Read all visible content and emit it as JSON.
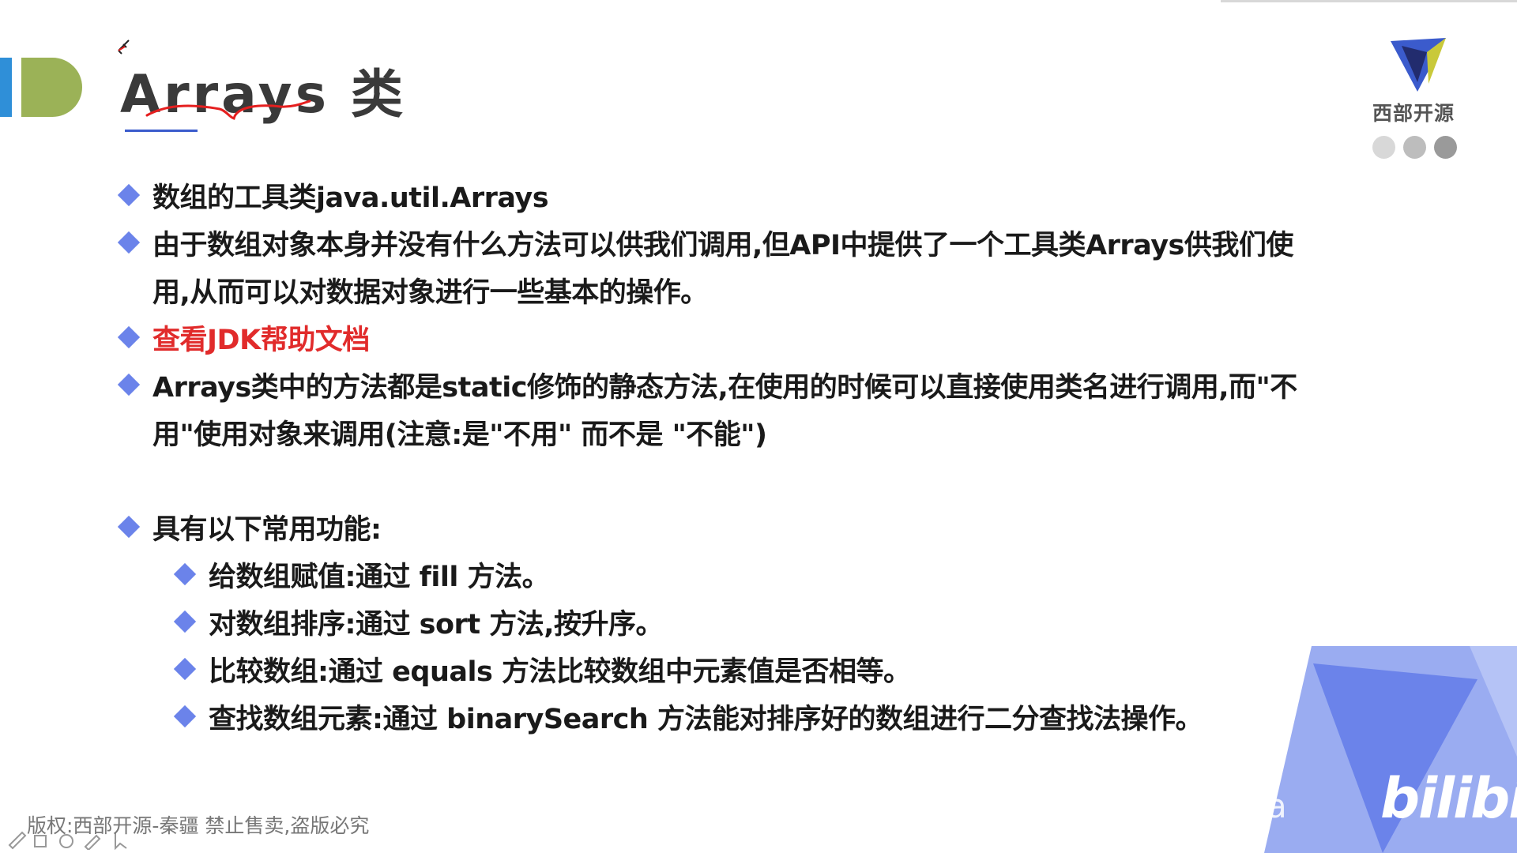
{
  "slide": {
    "title": "Arrays 类",
    "logo_text": "西部开源",
    "dots_colors": [
      "#d8d8d8",
      "#bdbdbd",
      "#9a9a9a"
    ]
  },
  "bullets": [
    {
      "level": 1,
      "lines": [
        "数组的工具类java.util.Arrays"
      ]
    },
    {
      "level": 1,
      "lines": [
        "由于数组对象本身并没有什么方法可以供我们调用,但API中提供了一个工具类Arrays供我们使",
        "用,从而可以对数据对象进行一些基本的操作。"
      ]
    },
    {
      "level": 1,
      "lines": [
        "查看JDK帮助文档"
      ],
      "color": "#e12b2b"
    },
    {
      "level": 1,
      "lines": [
        "Arrays类中的方法都是static修饰的静态方法,在使用的时候可以直接使用类名进行调用,而\"不",
        "用\"使用对象来调用(注意:是\"不用\" 而不是 \"不能\")"
      ]
    },
    {
      "level": 1,
      "lines": [
        "具有以下常用功能:"
      ]
    },
    {
      "level": 2,
      "lines": [
        "给数组赋值:通过 fill 方法。"
      ]
    },
    {
      "level": 2,
      "lines": [
        "对数组排序:通过 sort 方法,按升序。"
      ]
    },
    {
      "level": 2,
      "lines": [
        "比较数组:通过 equals 方法比较数组中元素值是否相等。"
      ]
    },
    {
      "level": 2,
      "lines": [
        "查找数组元素:通过 binarySearch 方法能对排序好的数组进行二分查找法操作。"
      ]
    }
  ],
  "footer": {
    "copyright": "版权:西部开源-秦疆    禁止售卖,盗版必究"
  },
  "watermark": {
    "text": "Java",
    "brand": "bilibili"
  },
  "colors": {
    "accent_blue": "#6b83ea",
    "accent_green": "#9bb257",
    "accent_bar": "#2f8fd8",
    "highlight_red": "#e12b2b"
  }
}
